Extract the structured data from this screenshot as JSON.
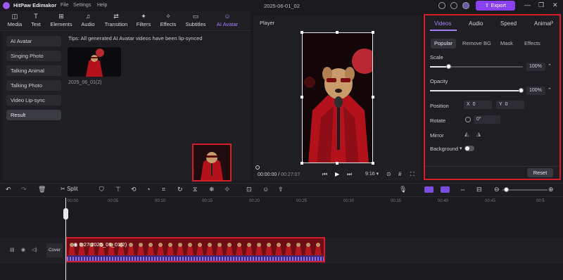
{
  "app": {
    "name": "HitPaw Edimakor",
    "menus": [
      "File",
      "Settings",
      "Help"
    ],
    "document_title": "2025-06-01_02",
    "export_label": "Export"
  },
  "toolbar": {
    "tools": [
      {
        "label": "Media",
        "icon": "media-icon"
      },
      {
        "label": "Text",
        "icon": "text-icon"
      },
      {
        "label": "Elements",
        "icon": "elements-icon"
      },
      {
        "label": "Audio",
        "icon": "audio-icon"
      },
      {
        "label": "Transition",
        "icon": "transition-icon"
      },
      {
        "label": "Filters",
        "icon": "filters-icon"
      },
      {
        "label": "Effects",
        "icon": "effects-icon"
      },
      {
        "label": "Subtitles",
        "icon": "subtitles-icon"
      },
      {
        "label": "AI Avatar",
        "icon": "ai-avatar-icon"
      }
    ],
    "active_tool": "AI Avatar"
  },
  "sidebar": {
    "items": [
      {
        "label": "AI Avatar"
      },
      {
        "label": "Singing Photo"
      },
      {
        "label": "Talking Animal"
      },
      {
        "label": "Talking Photo"
      },
      {
        "label": "Video Lip-sync"
      },
      {
        "label": "Result"
      }
    ],
    "selected": "Result"
  },
  "content": {
    "tips": "Tips: All generated AI Avatar videos have been lip-synced",
    "thumbnail_name": "2025_06_01(2)"
  },
  "player": {
    "title": "Player",
    "current_time": "00:00:00",
    "total_time": "00:27:07",
    "aspect": "9:16"
  },
  "properties": {
    "tabs": [
      "Videos",
      "Audio",
      "Speed",
      "Animati"
    ],
    "active_tab": "Videos",
    "subtabs": [
      "Popular",
      "Remove BG",
      "Mask",
      "Effects"
    ],
    "active_subtab": "Popular",
    "scale_label": "Scale",
    "scale_value": "100%",
    "scale_fraction": 0.2,
    "opacity_label": "Opacity",
    "opacity_value": "100%",
    "opacity_fraction": 1.0,
    "position_label": "Position",
    "pos_x_label": "X",
    "pos_x": "0",
    "pos_y_label": "Y",
    "pos_y": "0",
    "rotate_label": "Rotate",
    "rotate_value": "0°",
    "mirror_label": "Mirror",
    "background_label": "Background",
    "reset_label": "Reset"
  },
  "timeline": {
    "split_label": "Split",
    "ruler_ticks": [
      "00:00",
      "00:05",
      "00:10",
      "00:15",
      "00:20",
      "00:25",
      "00:30",
      "00:35",
      "00:40",
      "00:45",
      "00:5"
    ],
    "cover_label": "Cover",
    "clip_duration": "0:27",
    "clip_name": "2025_06_01(2)"
  },
  "colors": {
    "accent": "#a57dff",
    "export": "#8a3ff0",
    "highlight": "#d21f2b"
  }
}
